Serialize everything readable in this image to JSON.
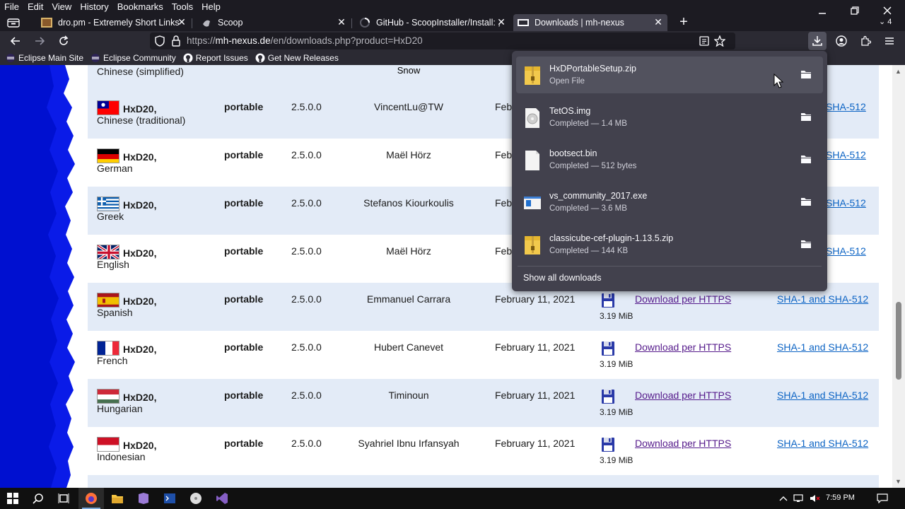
{
  "menu": [
    "File",
    "Edit",
    "View",
    "History",
    "Bookmarks",
    "Tools",
    "Help"
  ],
  "tabs": [
    {
      "title": "dro.pm - Extremely Short Links",
      "active": false
    },
    {
      "title": "Scoop",
      "active": false
    },
    {
      "title": "GitHub - ScoopInstaller/Install: ,",
      "active": false
    },
    {
      "title": "Downloads | mh-nexus",
      "active": true
    }
  ],
  "tab_overflow": "4",
  "address": {
    "url_prefix": "https://",
    "url_host": "mh-nexus.de",
    "url_path": "/en/downloads.php?product=HxD20"
  },
  "bookmarks": [
    {
      "label": "Eclipse Main Site",
      "icon": "eclipse-icon"
    },
    {
      "label": "Eclipse Community",
      "icon": "eclipse-icon"
    },
    {
      "label": "Report Issues",
      "icon": "github-icon"
    },
    {
      "label": "Get New Releases",
      "icon": "github-icon"
    }
  ],
  "top_row": {
    "language": "Chinese (simplified)",
    "author": "Snow"
  },
  "rows": [
    {
      "product": "HxD20,",
      "language": "Chinese (traditional)",
      "flag": "taiwan",
      "type": "portable",
      "version": "2.5.0.0",
      "author": "VincentLu@TW",
      "date": "Feb",
      "size": "",
      "download": "",
      "sha": "SHA-512"
    },
    {
      "product": "HxD20,",
      "language": "German",
      "flag": "germany",
      "type": "portable",
      "version": "2.5.0.0",
      "author": "Maël Hörz",
      "date": "Feb",
      "size": "",
      "download": "",
      "sha": "SHA-512"
    },
    {
      "product": "HxD20,",
      "language": "Greek",
      "flag": "greece",
      "type": "portable",
      "version": "2.5.0.0",
      "author": "Stefanos Kiourkoulis",
      "date": "Feb",
      "size": "",
      "download": "",
      "sha": "SHA-512"
    },
    {
      "product": "HxD20,",
      "language": "English",
      "flag": "uk",
      "type": "portable",
      "version": "2.5.0.0",
      "author": "Maël Hörz",
      "date": "Feb",
      "size": "",
      "download": "",
      "sha": "SHA-512"
    },
    {
      "product": "HxD20,",
      "language": "Spanish",
      "flag": "spain",
      "type": "portable",
      "version": "2.5.0.0",
      "author": "Emmanuel Carrara",
      "date": "February 11, 2021",
      "size": "3.19 MiB",
      "download": "Download per HTTPS",
      "sha": "SHA-1 and SHA-512"
    },
    {
      "product": "HxD20,",
      "language": "French",
      "flag": "france",
      "type": "portable",
      "version": "2.5.0.0",
      "author": "Hubert Canevet",
      "date": "February 11, 2021",
      "size": "3.19 MiB",
      "download": "Download per HTTPS",
      "sha": "SHA-1 and SHA-512"
    },
    {
      "product": "HxD20,",
      "language": "Hungarian",
      "flag": "hungary",
      "type": "portable",
      "version": "2.5.0.0",
      "author": "Timinoun",
      "date": "February 11, 2021",
      "size": "3.19 MiB",
      "download": "Download per HTTPS",
      "sha": "SHA-1 and SHA-512"
    },
    {
      "product": "HxD20,",
      "language": "Indonesian",
      "flag": "indonesia",
      "type": "portable",
      "version": "2.5.0.0",
      "author": "Syahriel Ibnu Irfansyah",
      "date": "February 11, 2021",
      "size": "3.19 MiB",
      "download": "Download per HTTPS",
      "sha": "SHA-1 and SHA-512"
    }
  ],
  "downloads_panel": {
    "items": [
      {
        "name": "HxDPortableSetup.zip",
        "status": "Open File",
        "icon": "zip-file-icon"
      },
      {
        "name": "TetOS.img",
        "status": "Completed — 1.4 MB",
        "icon": "disc-image-icon"
      },
      {
        "name": "bootsect.bin",
        "status": "Completed — 512 bytes",
        "icon": "blank-file-icon"
      },
      {
        "name": "vs_community_2017.exe",
        "status": "Completed — 3.6 MB",
        "icon": "exe-file-icon"
      },
      {
        "name": "classicube-cef-plugin-1.13.5.zip",
        "status": "Completed — 144 KB",
        "icon": "zip-file-icon"
      }
    ],
    "show_all": "Show all downloads"
  },
  "taskbar": {
    "clock": "7:59 PM"
  },
  "colors": {
    "accent_link": "#0b63c4",
    "visited_link": "#551a8b",
    "row_alt": "#e3ebf7",
    "panel_bg": "#42414d"
  }
}
